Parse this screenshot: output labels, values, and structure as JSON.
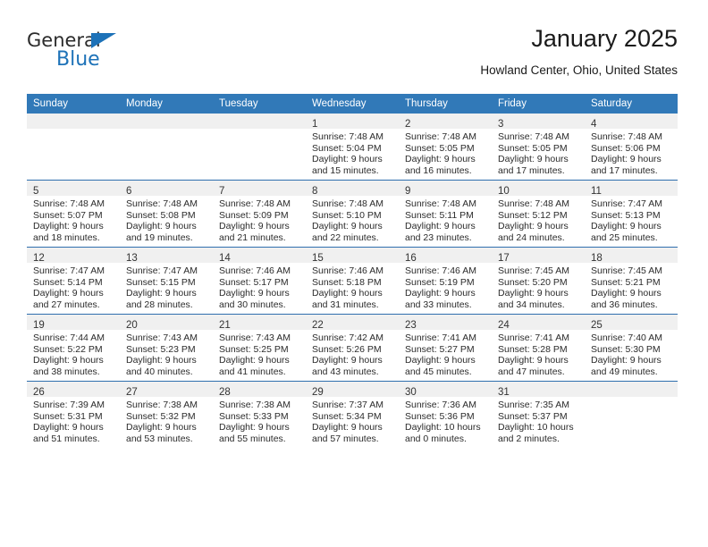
{
  "brand": {
    "name_top": "General",
    "name_bottom": "Blue",
    "accent_color": "#1d72b8"
  },
  "header": {
    "title": "January 2025",
    "subtitle": "Howland Center, Ohio, United States"
  },
  "theme": {
    "header_blue": "#3179b8",
    "row_divider_blue": "#2f6fae",
    "daynum_strip": "#f0f0f0",
    "text": "#2b2b2b"
  },
  "weekdays": [
    "Sunday",
    "Monday",
    "Tuesday",
    "Wednesday",
    "Thursday",
    "Friday",
    "Saturday"
  ],
  "weeks": [
    [
      {
        "day": "",
        "lines": []
      },
      {
        "day": "",
        "lines": []
      },
      {
        "day": "",
        "lines": []
      },
      {
        "day": "1",
        "lines": [
          "Sunrise: 7:48 AM",
          "Sunset: 5:04 PM",
          "Daylight: 9 hours",
          "and 15 minutes."
        ]
      },
      {
        "day": "2",
        "lines": [
          "Sunrise: 7:48 AM",
          "Sunset: 5:05 PM",
          "Daylight: 9 hours",
          "and 16 minutes."
        ]
      },
      {
        "day": "3",
        "lines": [
          "Sunrise: 7:48 AM",
          "Sunset: 5:05 PM",
          "Daylight: 9 hours",
          "and 17 minutes."
        ]
      },
      {
        "day": "4",
        "lines": [
          "Sunrise: 7:48 AM",
          "Sunset: 5:06 PM",
          "Daylight: 9 hours",
          "and 17 minutes."
        ]
      }
    ],
    [
      {
        "day": "5",
        "lines": [
          "Sunrise: 7:48 AM",
          "Sunset: 5:07 PM",
          "Daylight: 9 hours",
          "and 18 minutes."
        ]
      },
      {
        "day": "6",
        "lines": [
          "Sunrise: 7:48 AM",
          "Sunset: 5:08 PM",
          "Daylight: 9 hours",
          "and 19 minutes."
        ]
      },
      {
        "day": "7",
        "lines": [
          "Sunrise: 7:48 AM",
          "Sunset: 5:09 PM",
          "Daylight: 9 hours",
          "and 21 minutes."
        ]
      },
      {
        "day": "8",
        "lines": [
          "Sunrise: 7:48 AM",
          "Sunset: 5:10 PM",
          "Daylight: 9 hours",
          "and 22 minutes."
        ]
      },
      {
        "day": "9",
        "lines": [
          "Sunrise: 7:48 AM",
          "Sunset: 5:11 PM",
          "Daylight: 9 hours",
          "and 23 minutes."
        ]
      },
      {
        "day": "10",
        "lines": [
          "Sunrise: 7:48 AM",
          "Sunset: 5:12 PM",
          "Daylight: 9 hours",
          "and 24 minutes."
        ]
      },
      {
        "day": "11",
        "lines": [
          "Sunrise: 7:47 AM",
          "Sunset: 5:13 PM",
          "Daylight: 9 hours",
          "and 25 minutes."
        ]
      }
    ],
    [
      {
        "day": "12",
        "lines": [
          "Sunrise: 7:47 AM",
          "Sunset: 5:14 PM",
          "Daylight: 9 hours",
          "and 27 minutes."
        ]
      },
      {
        "day": "13",
        "lines": [
          "Sunrise: 7:47 AM",
          "Sunset: 5:15 PM",
          "Daylight: 9 hours",
          "and 28 minutes."
        ]
      },
      {
        "day": "14",
        "lines": [
          "Sunrise: 7:46 AM",
          "Sunset: 5:17 PM",
          "Daylight: 9 hours",
          "and 30 minutes."
        ]
      },
      {
        "day": "15",
        "lines": [
          "Sunrise: 7:46 AM",
          "Sunset: 5:18 PM",
          "Daylight: 9 hours",
          "and 31 minutes."
        ]
      },
      {
        "day": "16",
        "lines": [
          "Sunrise: 7:46 AM",
          "Sunset: 5:19 PM",
          "Daylight: 9 hours",
          "and 33 minutes."
        ]
      },
      {
        "day": "17",
        "lines": [
          "Sunrise: 7:45 AM",
          "Sunset: 5:20 PM",
          "Daylight: 9 hours",
          "and 34 minutes."
        ]
      },
      {
        "day": "18",
        "lines": [
          "Sunrise: 7:45 AM",
          "Sunset: 5:21 PM",
          "Daylight: 9 hours",
          "and 36 minutes."
        ]
      }
    ],
    [
      {
        "day": "19",
        "lines": [
          "Sunrise: 7:44 AM",
          "Sunset: 5:22 PM",
          "Daylight: 9 hours",
          "and 38 minutes."
        ]
      },
      {
        "day": "20",
        "lines": [
          "Sunrise: 7:43 AM",
          "Sunset: 5:23 PM",
          "Daylight: 9 hours",
          "and 40 minutes."
        ]
      },
      {
        "day": "21",
        "lines": [
          "Sunrise: 7:43 AM",
          "Sunset: 5:25 PM",
          "Daylight: 9 hours",
          "and 41 minutes."
        ]
      },
      {
        "day": "22",
        "lines": [
          "Sunrise: 7:42 AM",
          "Sunset: 5:26 PM",
          "Daylight: 9 hours",
          "and 43 minutes."
        ]
      },
      {
        "day": "23",
        "lines": [
          "Sunrise: 7:41 AM",
          "Sunset: 5:27 PM",
          "Daylight: 9 hours",
          "and 45 minutes."
        ]
      },
      {
        "day": "24",
        "lines": [
          "Sunrise: 7:41 AM",
          "Sunset: 5:28 PM",
          "Daylight: 9 hours",
          "and 47 minutes."
        ]
      },
      {
        "day": "25",
        "lines": [
          "Sunrise: 7:40 AM",
          "Sunset: 5:30 PM",
          "Daylight: 9 hours",
          "and 49 minutes."
        ]
      }
    ],
    [
      {
        "day": "26",
        "lines": [
          "Sunrise: 7:39 AM",
          "Sunset: 5:31 PM",
          "Daylight: 9 hours",
          "and 51 minutes."
        ]
      },
      {
        "day": "27",
        "lines": [
          "Sunrise: 7:38 AM",
          "Sunset: 5:32 PM",
          "Daylight: 9 hours",
          "and 53 minutes."
        ]
      },
      {
        "day": "28",
        "lines": [
          "Sunrise: 7:38 AM",
          "Sunset: 5:33 PM",
          "Daylight: 9 hours",
          "and 55 minutes."
        ]
      },
      {
        "day": "29",
        "lines": [
          "Sunrise: 7:37 AM",
          "Sunset: 5:34 PM",
          "Daylight: 9 hours",
          "and 57 minutes."
        ]
      },
      {
        "day": "30",
        "lines": [
          "Sunrise: 7:36 AM",
          "Sunset: 5:36 PM",
          "Daylight: 10 hours",
          "and 0 minutes."
        ]
      },
      {
        "day": "31",
        "lines": [
          "Sunrise: 7:35 AM",
          "Sunset: 5:37 PM",
          "Daylight: 10 hours",
          "and 2 minutes."
        ]
      },
      {
        "day": "",
        "lines": []
      }
    ]
  ]
}
